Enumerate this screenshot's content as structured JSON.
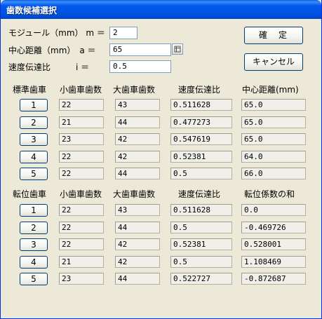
{
  "window": {
    "title": "歯数候補選択"
  },
  "inputs": {
    "module_label": "モジュール（mm） m ＝",
    "module_value": "2",
    "distance_label": "中心距離（mm）　a ＝",
    "distance_value": "65",
    "ratio_label": "速度伝達比　　　i ＝",
    "ratio_value": "0.5",
    "picker_icon": "ellipsis-picker-icon"
  },
  "buttons": {
    "ok": "確　定",
    "cancel": "キャンセル"
  },
  "standard": {
    "headers": [
      "標準歯車",
      "小歯車歯数",
      "大歯車歯数",
      "速度伝達比",
      "中心距離(mm)"
    ],
    "rows": [
      {
        "num": "1",
        "small": "22",
        "large": "43",
        "ratio": "0.511628",
        "last": "65.0"
      },
      {
        "num": "2",
        "small": "21",
        "large": "44",
        "ratio": "0.477273",
        "last": "65.0"
      },
      {
        "num": "3",
        "small": "23",
        "large": "42",
        "ratio": "0.547619",
        "last": "65.0"
      },
      {
        "num": "4",
        "small": "22",
        "large": "42",
        "ratio": "0.52381",
        "last": "64.0"
      },
      {
        "num": "5",
        "small": "22",
        "large": "44",
        "ratio": "0.5",
        "last": "66.0"
      }
    ]
  },
  "shifted": {
    "headers": [
      "転位歯車",
      "小歯車歯数",
      "大歯車歯数",
      "速度伝達比",
      "転位係数の和"
    ],
    "rows": [
      {
        "num": "1",
        "small": "22",
        "large": "43",
        "ratio": "0.511628",
        "last": "0.0"
      },
      {
        "num": "2",
        "small": "22",
        "large": "44",
        "ratio": "0.5",
        "last": "-0.469726"
      },
      {
        "num": "3",
        "small": "22",
        "large": "42",
        "ratio": "0.52381",
        "last": "0.528001"
      },
      {
        "num": "4",
        "small": "21",
        "large": "42",
        "ratio": "0.5",
        "last": "1.108469"
      },
      {
        "num": "5",
        "small": "23",
        "large": "44",
        "ratio": "0.522727",
        "last": "-0.872687"
      }
    ]
  }
}
